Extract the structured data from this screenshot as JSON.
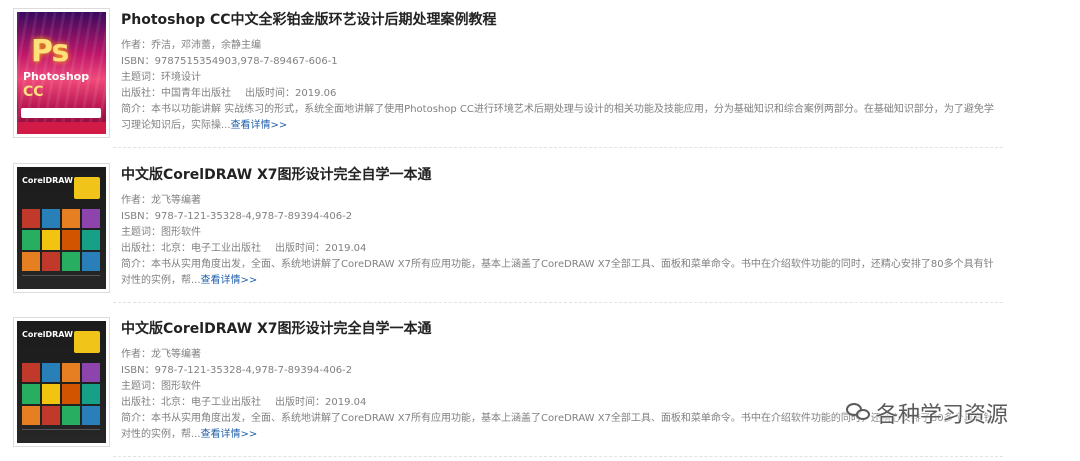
{
  "labels": {
    "author": "作者：",
    "isbn": "ISBN：",
    "subject": "主题词：",
    "publisher": "出版社：",
    "pubdate": "出版时间：",
    "summary": "简介：",
    "more": "查看详情>>"
  },
  "books": [
    {
      "title": "Photoshop CC中文全彩铂金版环艺设计后期处理案例教程",
      "author": "乔洁，邓沛蕾，余静主编",
      "isbn": "9787515354903,978-7-89467-606-1",
      "subject": "环境设计",
      "publisher": "中国青年出版社",
      "pubdate": "2019.06",
      "summary": "本书以功能讲解 实战练习的形式，系统全面地讲解了使用Photoshop CC进行环境艺术后期处理与设计的相关功能及技能应用，分为基础知识和综合案例两部分。在基础知识部分，为了避免学习理论知识后，实际操...",
      "cover": {
        "logo": "Ps",
        "word": "Photoshop",
        "cc": "CC"
      }
    },
    {
      "title": "中文版CorelDRAW X7图形设计完全自学一本通",
      "author": "龙飞等编著",
      "isbn": "978-7-121-35328-4,978-7-89394-406-2",
      "subject": "图形软件",
      "publisher": "北京：电子工业出版社",
      "pubdate": "2019.04",
      "summary": "本书从实用角度出发，全面、系统地讲解了CoreDRAW X7所有应用功能，基本上涵盖了CoreDRAW X7全部工具、面板和菜单命令。书中在介绍软件功能的同时，还精心安排了80多个具有针对性的实例，帮...",
      "cover": {
        "title": "CorelDRAW X7"
      }
    },
    {
      "title": "中文版CorelDRAW X7图形设计完全自学一本通",
      "author": "龙飞等编著",
      "isbn": "978-7-121-35328-4,978-7-89394-406-2",
      "subject": "图形软件",
      "publisher": "北京：电子工业出版社",
      "pubdate": "2019.04",
      "summary": "本书从实用角度出发，全面、系统地讲解了CoreDRAW X7所有应用功能，基本上涵盖了CoreDRAW X7全部工具、面板和菜单命令。书中在介绍软件功能的同时，还精心安排了80多个具有针对性的实例，帮...",
      "cover": {
        "title": "CorelDRAW X7"
      }
    }
  ],
  "watermark": {
    "text": "各种学习资源",
    "icon": "wechat-icon"
  },
  "colors": {
    "link": "#1f5faa",
    "meta_text": "#808080",
    "title": "#222222"
  }
}
